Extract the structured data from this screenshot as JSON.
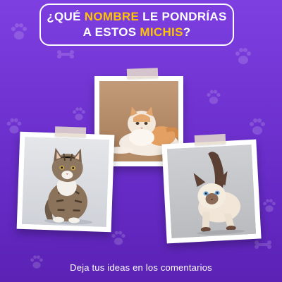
{
  "headline": {
    "line1_pre": "¿QUÉ ",
    "line1_highlight": "NOMBRE",
    "line1_post": " LE PONDRÍAS",
    "line2_pre": "A ESTOS ",
    "line2_highlight": "MICHIS",
    "line2_post": "?"
  },
  "caption": "Deja tus ideas en los comentarios",
  "colors": {
    "background": "#6a2ecb",
    "highlight": "#ffc400",
    "text": "#ffffff"
  },
  "photos": [
    {
      "subject": "long-haired-cream-white-cat"
    },
    {
      "subject": "tabby-maine-coon-kitten"
    },
    {
      "subject": "siamese-kitten"
    }
  ]
}
